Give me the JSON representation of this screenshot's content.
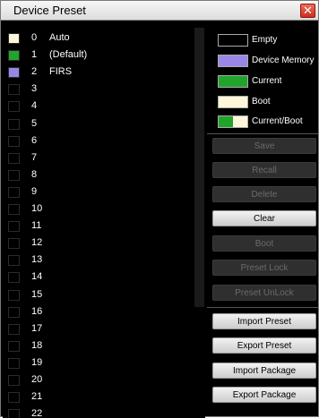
{
  "window": {
    "title": "Device Preset"
  },
  "colors": {
    "empty": "#000000",
    "device_memory": "#9a86e8",
    "current": "#22a32c",
    "boot": "#fff7d9"
  },
  "presets": [
    {
      "num": "0",
      "name": "Auto",
      "state": "boot"
    },
    {
      "num": "1",
      "name": "(Default)",
      "state": "current"
    },
    {
      "num": "2",
      "name": "FIRS",
      "state": "device_memory"
    },
    {
      "num": "3",
      "name": "",
      "state": "empty"
    },
    {
      "num": "4",
      "name": "",
      "state": "empty"
    },
    {
      "num": "5",
      "name": "",
      "state": "empty"
    },
    {
      "num": "6",
      "name": "",
      "state": "empty"
    },
    {
      "num": "7",
      "name": "",
      "state": "empty"
    },
    {
      "num": "8",
      "name": "",
      "state": "empty"
    },
    {
      "num": "9",
      "name": "",
      "state": "empty"
    },
    {
      "num": "10",
      "name": "",
      "state": "empty"
    },
    {
      "num": "11",
      "name": "",
      "state": "empty"
    },
    {
      "num": "12",
      "name": "",
      "state": "empty"
    },
    {
      "num": "13",
      "name": "",
      "state": "empty"
    },
    {
      "num": "14",
      "name": "",
      "state": "empty"
    },
    {
      "num": "15",
      "name": "",
      "state": "empty"
    },
    {
      "num": "16",
      "name": "",
      "state": "empty"
    },
    {
      "num": "17",
      "name": "",
      "state": "empty"
    },
    {
      "num": "18",
      "name": "",
      "state": "empty"
    },
    {
      "num": "19",
      "name": "",
      "state": "empty"
    },
    {
      "num": "20",
      "name": "",
      "state": "empty"
    },
    {
      "num": "21",
      "name": "",
      "state": "empty"
    },
    {
      "num": "22",
      "name": "",
      "state": "empty"
    }
  ],
  "legend": {
    "empty": "Empty",
    "device_memory": "Device Memory",
    "current": "Current",
    "boot": "Boot",
    "current_boot": "Current/Boot"
  },
  "buttons": {
    "save": "Save",
    "recall": "Recall",
    "delete": "Delete",
    "clear": "Clear",
    "boot": "Boot",
    "preset_lock": "Preset Lock",
    "preset_unlock": "Preset UnLock",
    "import_preset": "Import Preset",
    "export_preset": "Export Preset",
    "import_package": "Import Package",
    "export_package": "Export Package"
  },
  "icons": {
    "close": "close-icon"
  }
}
